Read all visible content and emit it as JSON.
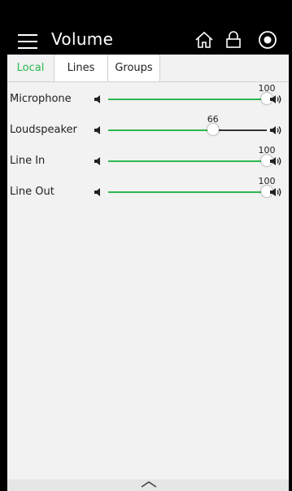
{
  "header": {
    "title": "Volume",
    "icons": [
      "menu-icon",
      "home-icon",
      "lock-icon",
      "stop-icon"
    ]
  },
  "tabs": [
    {
      "label": "Local",
      "active": true
    },
    {
      "label": "Lines",
      "active": false
    },
    {
      "label": "Groups",
      "active": false
    }
  ],
  "channels": [
    {
      "label": "Microphone",
      "value": "100",
      "level": 100
    },
    {
      "label": "Loudspeaker",
      "value": "66",
      "level": 66
    },
    {
      "label": "Line In",
      "value": "100",
      "level": 100
    },
    {
      "label": "Line Out",
      "value": "100",
      "level": 100
    }
  ],
  "colors": {
    "accent": "#2db84e",
    "header_bg": "#000000",
    "content_bg": "#f2f2f2"
  },
  "footer": {
    "icon": "chevron-up-icon"
  }
}
